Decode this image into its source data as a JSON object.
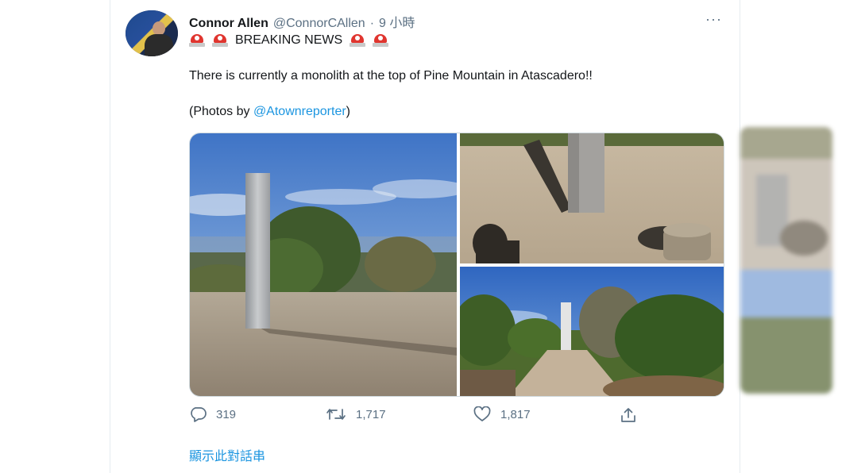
{
  "tweet": {
    "author_name": "Connor Allen",
    "handle": "@ConnorCAllen",
    "separator": "·",
    "time": "9 小時",
    "more_label": "···",
    "breaking_text": "BREAKING NEWS",
    "body_line": "There is currently a monolith at the top of Pine Mountain in Atascadero!!",
    "credit_prefix": "(Photos by ",
    "credit_link": "@Atownreporter",
    "credit_suffix": ")",
    "icons": [
      "reply-icon",
      "retweet-icon",
      "like-icon",
      "share-icon",
      "police-light-icon"
    ],
    "replies": "319",
    "retweets": "1,717",
    "likes": "1,817",
    "show_thread": "顯示此對話串"
  },
  "colors": {
    "text": "#14171a",
    "muted": "#5b7083",
    "link": "#1b95e0",
    "siren": "#e0352f"
  }
}
